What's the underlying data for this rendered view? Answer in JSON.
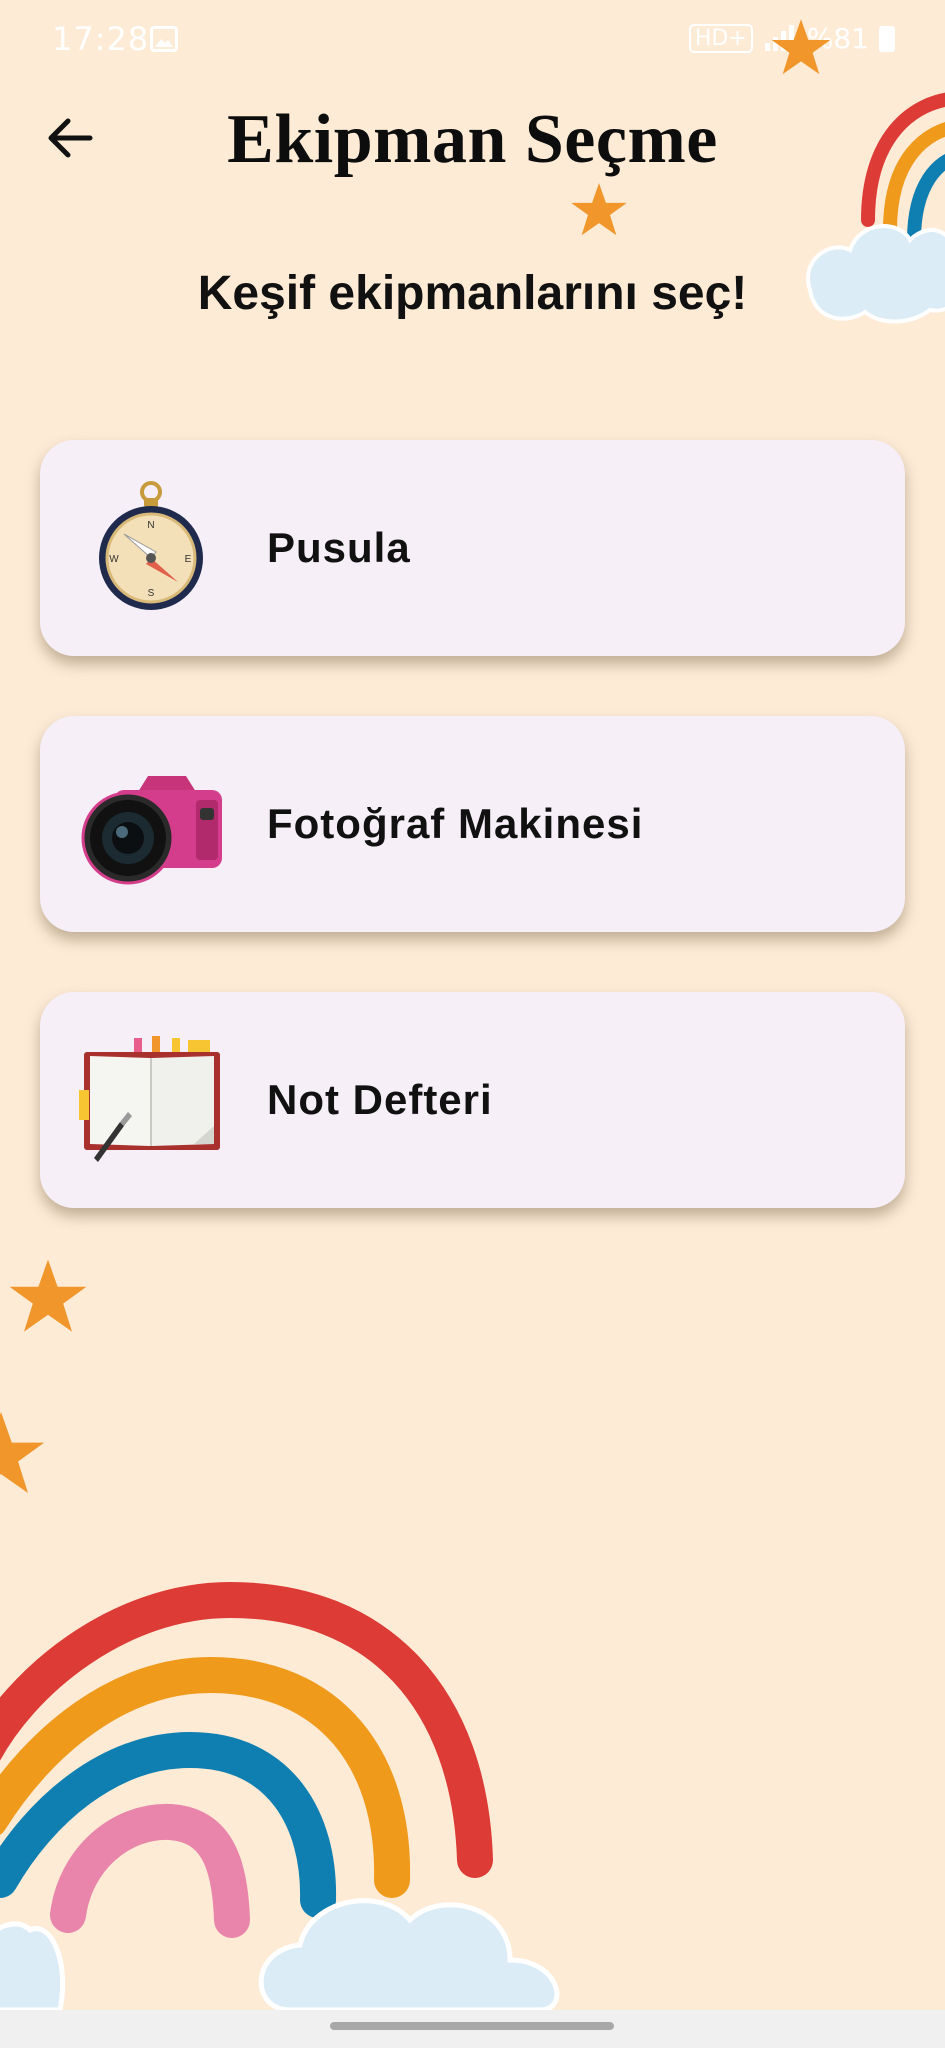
{
  "status_bar": {
    "time": "17:28",
    "network": "HD+",
    "battery": "%81"
  },
  "header": {
    "title": "Ekipman Seçme",
    "subtitle": "Keşif ekipmanlarını seç!"
  },
  "equipment": [
    {
      "label": "Pusula",
      "icon": "compass-icon"
    },
    {
      "label": "Fotoğraf Makinesi",
      "icon": "camera-icon"
    },
    {
      "label": "Not Defteri",
      "icon": "notebook-icon"
    }
  ],
  "colors": {
    "background": "#fdebd6",
    "card": "#f6eff8",
    "star": "#f0962a",
    "rainbow_red": "#dd3b36",
    "rainbow_orange": "#f09a1c",
    "rainbow_blue": "#0f7fb1",
    "rainbow_pink": "#e985aa",
    "cloud": "#dcecf7"
  }
}
